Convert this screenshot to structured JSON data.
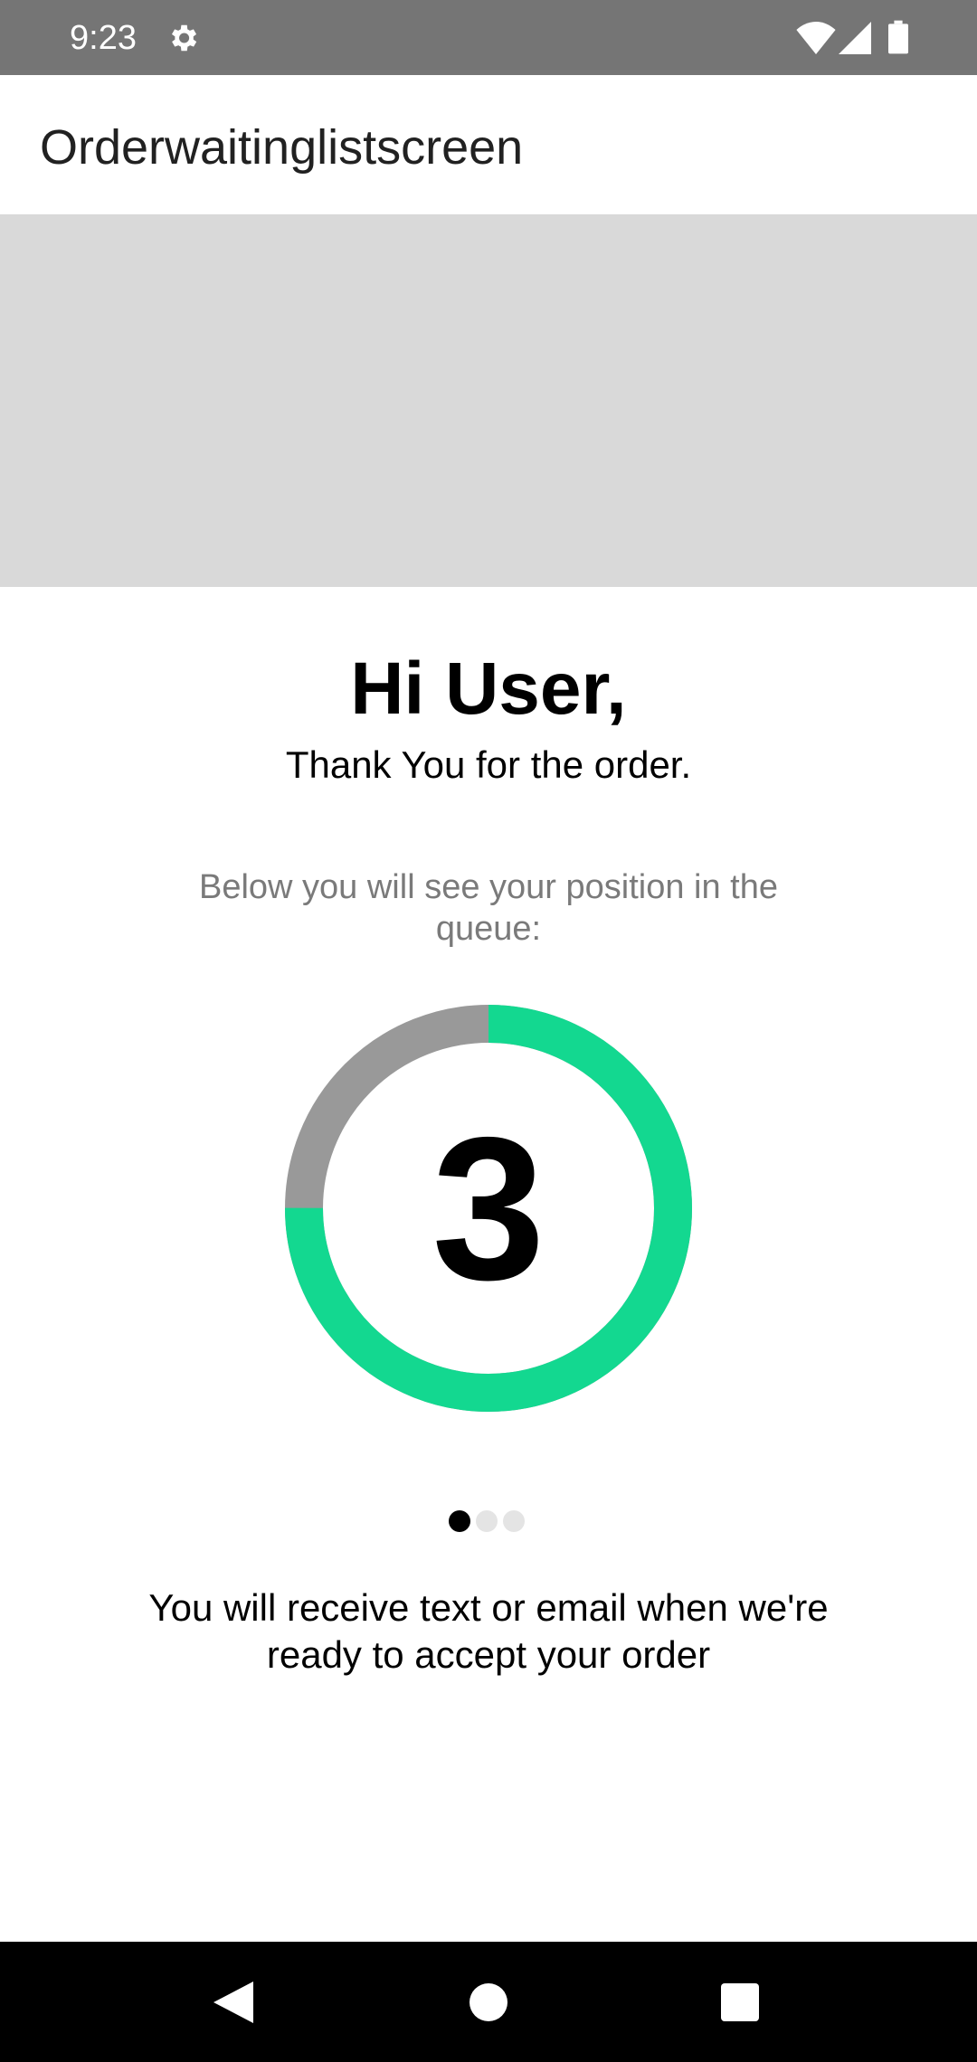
{
  "status_bar": {
    "time": "9:23",
    "icons": [
      "gear-icon",
      "wifi-icon",
      "signal-icon",
      "battery-icon"
    ]
  },
  "app_bar": {
    "title": "Orderwaitinglistscreen"
  },
  "content": {
    "greeting": "Hi User,",
    "thanks": "Thank You for the order.",
    "queue_description": "Below you will see your position in the queue:",
    "queue_position": "3",
    "progress_fraction": 0.75,
    "page_indicator": {
      "count": 3,
      "active_index": 0
    },
    "notice": "You will receive text or email when we're ready to accept your order"
  },
  "colors": {
    "accent": "#13d890",
    "ring_track": "#999999",
    "status_bar": "#757575",
    "banner": "#d9d9d9"
  },
  "nav_bar": {
    "icons": [
      "back-icon",
      "home-icon",
      "recents-icon"
    ]
  }
}
